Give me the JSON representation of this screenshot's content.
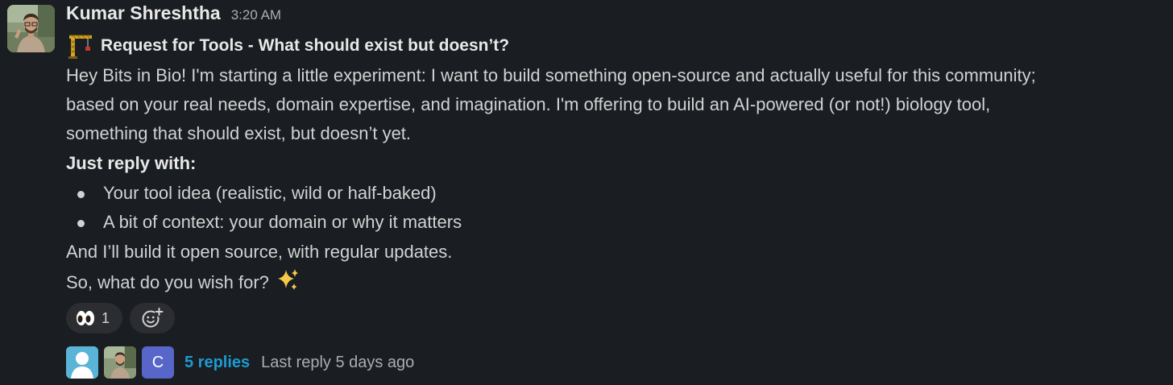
{
  "message": {
    "author": "Kumar Shreshtha",
    "timestamp": "3:20 AM",
    "title_icon": "construction-crane-icon",
    "title": "Request for Tools - What should exist but doesn’t?",
    "body": {
      "line1": "Hey Bits in Bio! I'm starting a little experiment: I want to build something open-source and actually useful for this community;",
      "line2": "based on your real needs, domain expertise, and imagination. I'm offering to build an AI-powered (or not!) biology tool,",
      "line3": "something that should exist, but doesn’t yet.",
      "bold_line": "Just reply with:",
      "bullets": [
        "Your tool idea (realistic, wild or half-baked)",
        "A bit of context: your domain or why it matters"
      ],
      "line4": "And I’ll build it open source, with regular updates.",
      "line5": "So, what do you wish for?",
      "line5_icon": "sparkles-icon"
    }
  },
  "reactions": [
    {
      "emoji": "eyes-icon",
      "count": "1"
    }
  ],
  "add_reaction_icon": "add-reaction-icon",
  "thread": {
    "participants": [
      "person-placeholder-icon",
      "author-photo",
      "C"
    ],
    "replies_label": "5 replies",
    "last_reply": "Last reply 5 days ago"
  },
  "colors": {
    "background": "#1a1d21",
    "text": "#d1d2d3",
    "link": "#1d9bd1",
    "pill": "#2b2d31",
    "avatar_c": "#5865c9",
    "avatar_placeholder": "#5ab4d8"
  }
}
